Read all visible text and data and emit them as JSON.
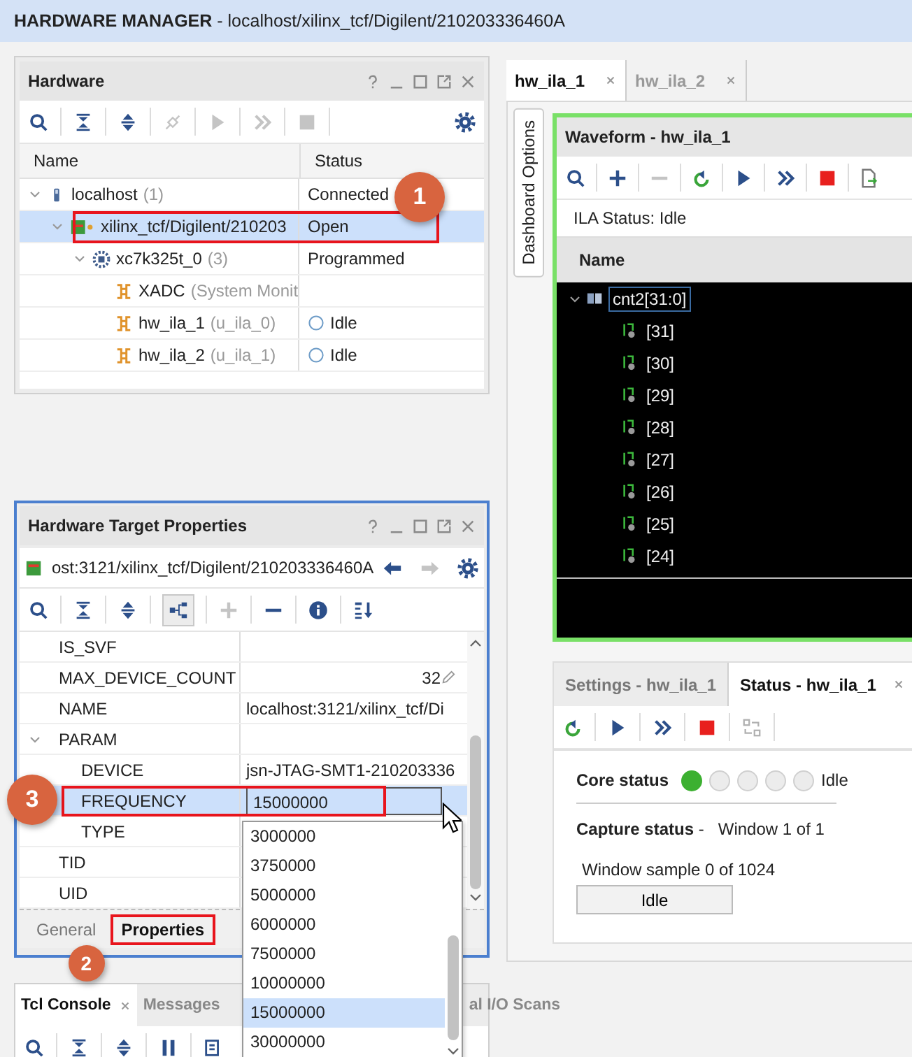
{
  "window": {
    "title": "**HARDWARE MANAGER** - localhost/xilinx_tcf/Digilent/210203336460A"
  },
  "hardware_panel": {
    "title": "Hardware",
    "columns": [
      "Name",
      "Status"
    ],
    "tree": [
      {
        "kind": "host",
        "name": "localhost",
        "count": "(1)",
        "status": "Connected",
        "selected": false,
        "expanded": true,
        "children": [
          {
            "kind": "target",
            "name": "xilinx_tcf/Digilent/210203",
            "status": "Open",
            "selected": true,
            "expanded": true,
            "callout": "1",
            "children": [
              {
                "kind": "device",
                "name": "xc7k325t_0",
                "count": "(3)",
                "status": "Programmed",
                "selected": false,
                "expanded": true,
                "children": [
                  {
                    "kind": "core",
                    "name": "XADC",
                    "count": "(System Monit",
                    "selected": false
                  },
                  {
                    "kind": "core",
                    "name": "hw_ila_1",
                    "count": "(u_ila_0)",
                    "status": "Idle",
                    "selected": false
                  },
                  {
                    "kind": "core",
                    "name": "hw_ila_2",
                    "count": "(u_ila_1)",
                    "status": "Idle",
                    "selected": false
                  }
                ]
              }
            ]
          }
        ]
      }
    ]
  },
  "properties_panel": {
    "title": "Hardware Target Properties",
    "object_path": "ost:3121/xilinx_tcf/Digilent/210203336460A",
    "rows": [
      {
        "name": "IS_SVF",
        "selected": false,
        "editable": false
      },
      {
        "name": "MAX_DEVICE_COUNT",
        "value": "32",
        "selected": false,
        "editable": true
      },
      {
        "name": "NAME",
        "value": "localhost:3121/xilinx_tcf/Di",
        "selected": false,
        "editable": false
      },
      {
        "name": "PARAM",
        "selected": false,
        "editable": false,
        "expanded": true,
        "children": [
          {
            "name": "DEVICE",
            "value": "jsn-JTAG-SMT1-210203336",
            "selected": false,
            "editable": false
          },
          {
            "name": "FREQUENCY",
            "value": "15000000",
            "selected": true,
            "editable": false,
            "callout": "3"
          },
          {
            "name": "TYPE",
            "selected": false,
            "editable": false
          }
        ]
      },
      {
        "name": "TID",
        "selected": false,
        "editable": false
      },
      {
        "name": "UID",
        "selected": false,
        "editable": false
      }
    ],
    "tabs": [
      {
        "label": "General",
        "selected": false
      },
      {
        "label": "Properties",
        "selected": true,
        "callout": "2"
      }
    ]
  },
  "frequency_dropdown": {
    "options": [
      {
        "label": "3000000",
        "selected": false
      },
      {
        "label": "3750000",
        "selected": false
      },
      {
        "label": "5000000",
        "selected": false
      },
      {
        "label": "6000000",
        "selected": false
      },
      {
        "label": "7500000",
        "selected": false
      },
      {
        "label": "10000000",
        "selected": false
      },
      {
        "label": "15000000",
        "selected": true
      },
      {
        "label": "30000000",
        "selected": false
      }
    ]
  },
  "console_panel": {
    "tabs": [
      {
        "label": "Tcl Console",
        "selected": true
      },
      {
        "label": "Messages",
        "selected": false
      },
      {
        "label": "al I/O Scans",
        "selected": false
      }
    ]
  },
  "ila_tabs": [
    {
      "label": "hw_ila_1",
      "selected": true
    },
    {
      "label": "hw_ila_2",
      "selected": false
    }
  ],
  "side_tab": "Dashboard Options",
  "waveform": {
    "title": "Waveform - hw_ila_1",
    "ila_status": "ILA Status: Idle",
    "column": "Name",
    "signals": [
      {
        "name": "cnt2[31:0]",
        "expanded": true,
        "children": [
          {
            "name": "[31]"
          },
          {
            "name": "[30]"
          },
          {
            "name": "[29]"
          },
          {
            "name": "[28]"
          },
          {
            "name": "[27]"
          },
          {
            "name": "[26]"
          },
          {
            "name": "[25]"
          },
          {
            "name": "[24]"
          }
        ]
      }
    ]
  },
  "status_panel": {
    "tabs": [
      {
        "label": "Settings - hw_ila_1",
        "selected": false
      },
      {
        "label": "Status - hw_ila_1",
        "selected": true
      }
    ],
    "core_status": {
      "label": "Core status",
      "lamps": [
        {
          "on": true
        },
        {
          "on": false
        },
        {
          "on": false
        },
        {
          "on": false
        },
        {
          "on": false
        }
      ],
      "state": "Idle"
    },
    "capture_status": {
      "label": "**Capture status** -",
      "value": "Window 1 of 1"
    },
    "window_sample": "Window sample 0 of 1024",
    "button": "Idle"
  }
}
